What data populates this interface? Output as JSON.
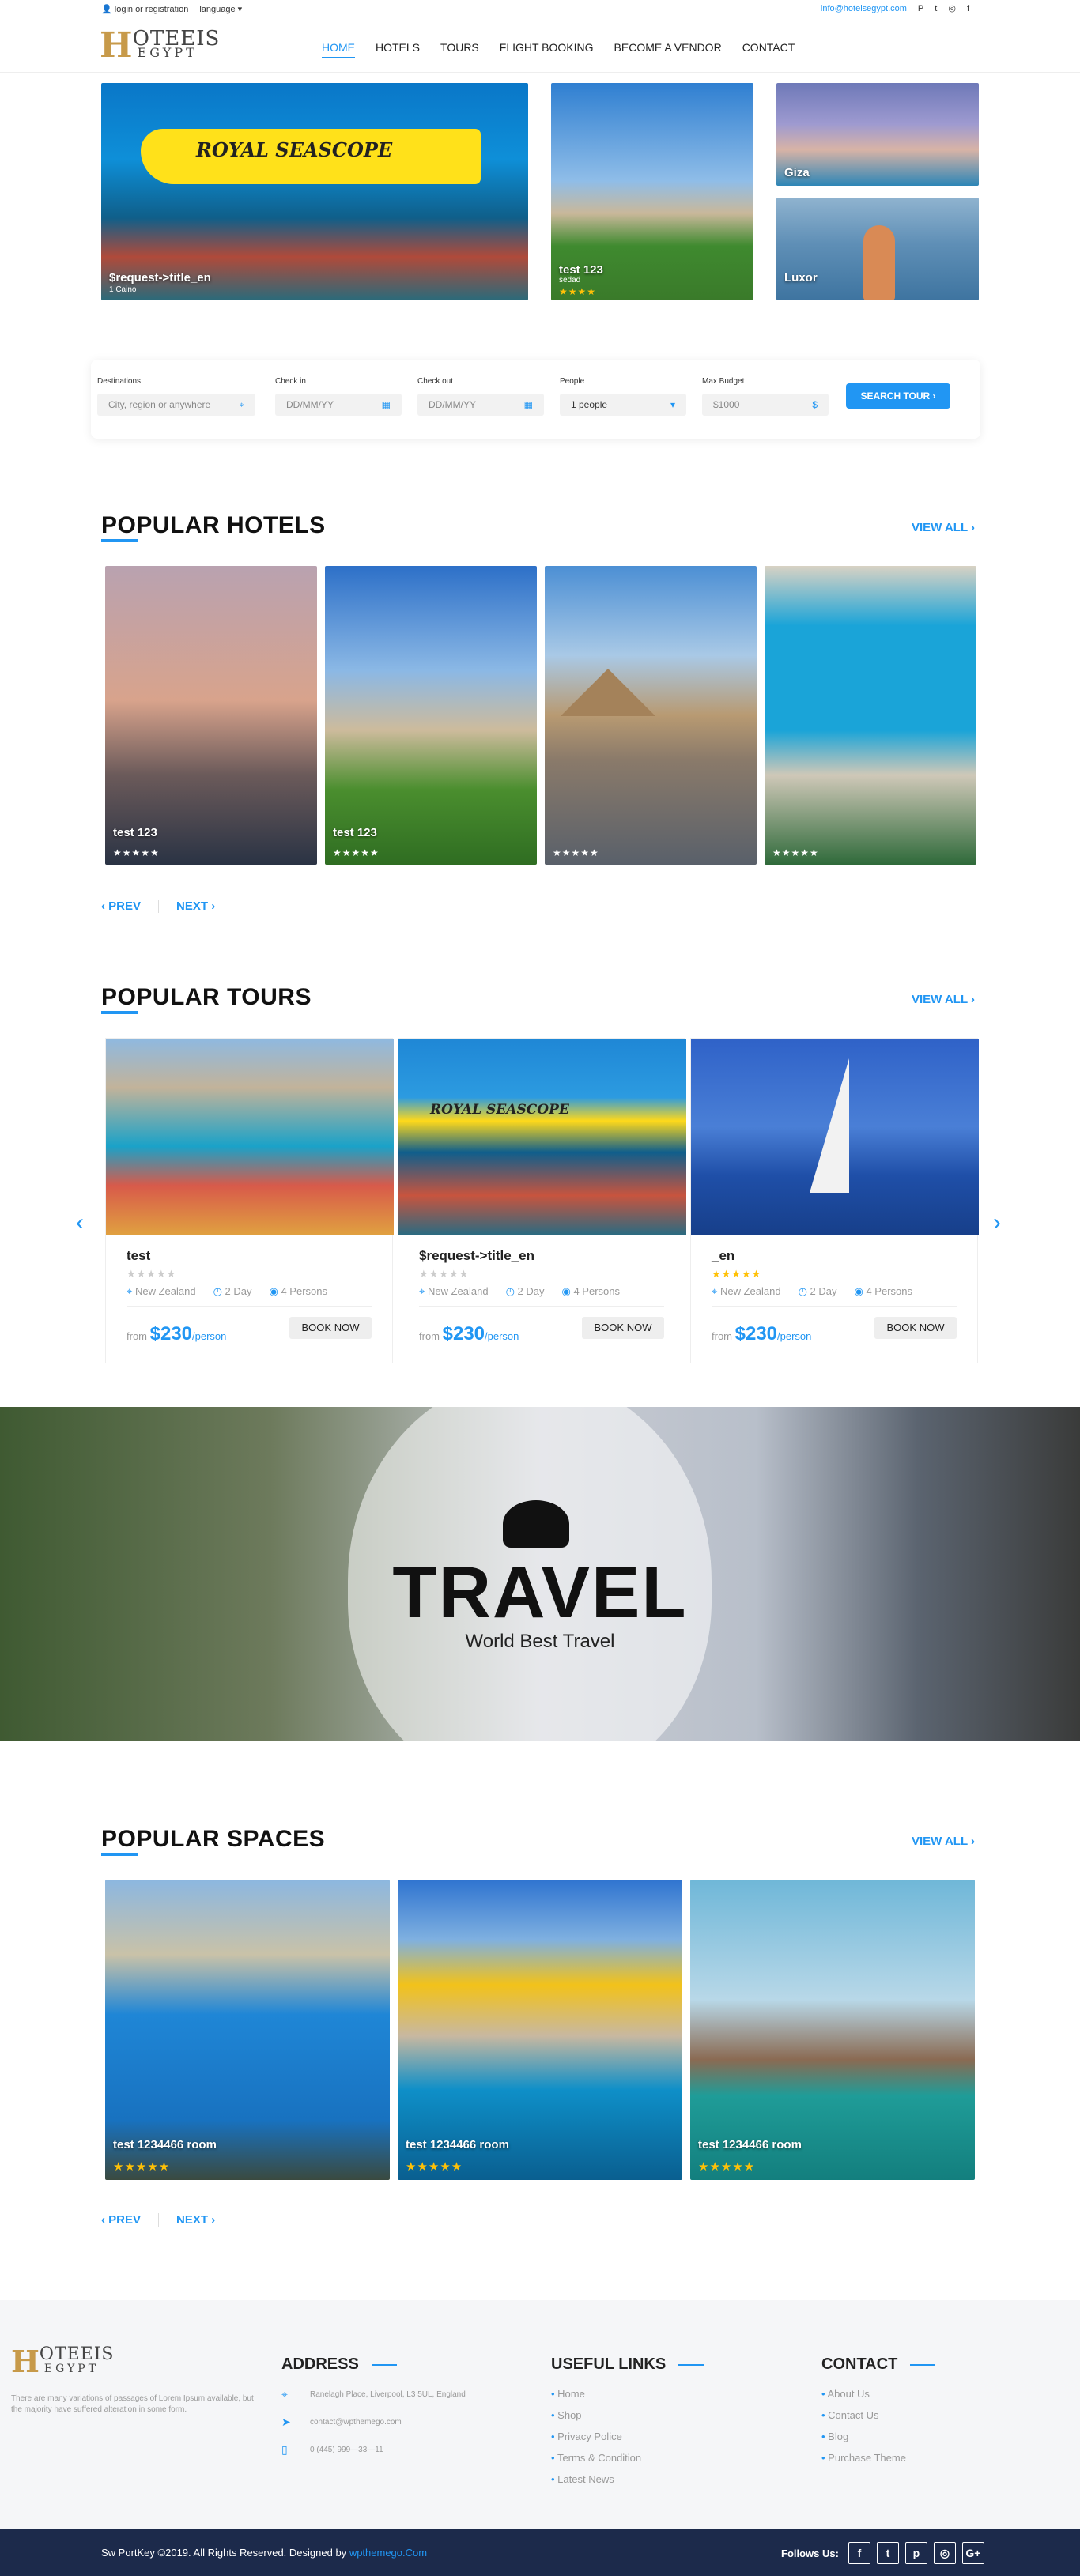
{
  "topbar": {
    "login": "login or registration",
    "language": "language",
    "email": "info@hotelsegypt.com",
    "social": [
      "P",
      "t",
      "◎",
      "f"
    ]
  },
  "brand": {
    "mark": "H",
    "word1": "OTEEIS",
    "word2": "EGYPT"
  },
  "menu": [
    "HOME",
    "HOTELS",
    "TOURS",
    "FLIGHT BOOKING",
    "BECOME A VENDOR",
    "CONTACT"
  ],
  "hero": {
    "main": {
      "title": "$request->title_en",
      "sub": "1 Caino",
      "banner": "ROYAL SEASCOPE"
    },
    "mid": {
      "title": "test 123",
      "sub": "sedad",
      "stars": "★★★★"
    },
    "giza": "Giza",
    "luxor": "Luxor"
  },
  "search": {
    "fields": [
      {
        "label": "Destinations",
        "value": "City, region or anywhere",
        "icon": "⌖"
      },
      {
        "label": "Check in",
        "value": "DD/MM/YY",
        "icon": "▦"
      },
      {
        "label": "Check out",
        "value": "DD/MM/YY",
        "icon": "▦"
      },
      {
        "label": "People",
        "value": "1 people",
        "icon": "▾"
      },
      {
        "label": "Max Budget",
        "value": "$1000",
        "icon": "$"
      }
    ],
    "button": "SEARCH TOUR  ›"
  },
  "hotels": {
    "title": "POPULAR HOTELS",
    "view_all": "VIEW ALL ›",
    "items": [
      {
        "name": "test 123",
        "stars": "★★★★★"
      },
      {
        "name": "test 123",
        "stars": "★★★★★"
      },
      {
        "name": "",
        "stars": "★★★★★"
      },
      {
        "name": "",
        "stars": "★★★★★"
      }
    ],
    "prev": "‹  PREV",
    "next": "NEXT  ›"
  },
  "tours": {
    "title": "POPULAR TOURS",
    "view_all": "VIEW ALL ›",
    "items": [
      {
        "name": "test",
        "stars": "★★★★★",
        "loc": "New Zealand",
        "days": "2 Day",
        "persons": "4 Persons",
        "from": "from",
        "price": "$230",
        "unit": "/person",
        "book": "BOOK NOW"
      },
      {
        "name": "$request->title_en",
        "stars": "★★★★★",
        "loc": "New Zealand",
        "days": "2 Day",
        "persons": "4 Persons",
        "from": "from",
        "price": "$230",
        "unit": "/person",
        "book": "BOOK NOW"
      },
      {
        "name": "_en",
        "stars": "★★★★★",
        "loc": "New Zealand",
        "days": "2 Day",
        "persons": "4 Persons",
        "from": "from",
        "price": "$230",
        "unit": "/person",
        "book": "BOOK NOW"
      }
    ]
  },
  "banner": {
    "title": "TRAVEL",
    "subtitle": "World Best Travel"
  },
  "spaces": {
    "title": "POPULAR SPACES",
    "view_all": "VIEW ALL ›",
    "items": [
      {
        "name": "test 1234466 room",
        "stars": "★★★★★"
      },
      {
        "name": "test 1234466 room",
        "stars": "★★★★★"
      },
      {
        "name": "test 1234466 room",
        "stars": "★★★★★"
      }
    ],
    "prev": "‹  PREV",
    "next": "NEXT  ›"
  },
  "footer": {
    "about": "There are many variations of passages of Lorem Ipsum available, but the majority have suffered alteration in some form.",
    "address_title": "ADDRESS",
    "address": [
      "Ranelagh Place, Liverpool, L3 5UL, England",
      "contact@wpthemego.com",
      "0 (445) 999—33—11"
    ],
    "links_title": "USEFUL LINKS",
    "links": [
      "Home",
      "Shop",
      "Privacy Police",
      "Terms & Condition",
      "Latest News"
    ],
    "contact_title": "CONTACT",
    "contact": [
      "About Us",
      "Contact Us",
      "Blog",
      "Purchase Theme"
    ]
  },
  "bottom": {
    "copy": "Sw PortKey ©2019. All Rights Reserved. Designed by",
    "designer": "wpthemego.Com",
    "follow": "Follows Us:",
    "social": [
      "f",
      "t",
      "p",
      "◎",
      "G+"
    ]
  },
  "colors": {
    "accent": "#2196f3",
    "footer_bar": "#1c2a4b",
    "star": "#ffc107"
  }
}
